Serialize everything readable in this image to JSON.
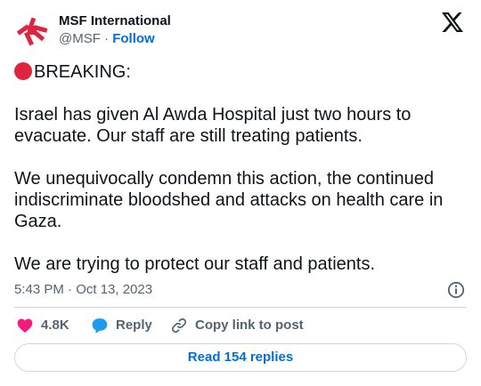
{
  "header": {
    "display_name": "MSF International",
    "handle": "@MSF",
    "separator": "·",
    "follow_label": "Follow"
  },
  "tweet": {
    "line_breaking": "BREAKING:",
    "paragraph_1": "Israel has given Al Awda Hospital just two hours to evacuate. Our staff are still treating patients.",
    "paragraph_2": "We unequivocally condemn this action, the continued indiscriminate bloodshed and attacks on health care in Gaza.",
    "paragraph_3": "We are trying to protect our staff and patients."
  },
  "meta": {
    "timestamp": "5:43 PM · Oct 13, 2023"
  },
  "actions": {
    "like_count": "4.8K",
    "reply_label": "Reply",
    "copy_label": "Copy link to post"
  },
  "replies_button": {
    "label": "Read 154 replies"
  },
  "colors": {
    "accent": "#006fd6",
    "like_red": "#f91880",
    "msf_red": "#e0243d",
    "muted": "#536471"
  },
  "icons": {
    "avatar": "msf-logo-icon",
    "brand": "x-logo-icon",
    "breaking": "red-circle-icon",
    "info": "info-icon",
    "like": "heart-icon",
    "reply": "speech-bubble-icon",
    "copy": "link-icon"
  }
}
